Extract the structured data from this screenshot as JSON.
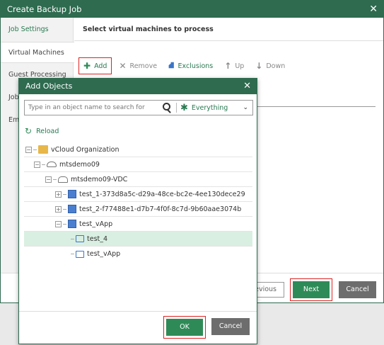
{
  "wizard": {
    "title": "Create Backup Job",
    "steps": [
      "Job Settings",
      "Virtual Machines",
      "Guest Processing",
      "Job",
      "Em"
    ],
    "heading": "Select virtual machines to process",
    "toolbar": {
      "add": "Add",
      "remove": "Remove",
      "exclusions": "Exclusions",
      "up": "Up",
      "down": "Down"
    },
    "footer": {
      "previous": "evious",
      "next": "Next",
      "cancel": "Cancel"
    }
  },
  "dialog": {
    "title": "Add Objects",
    "search_placeholder": "Type in an object name to search for",
    "scope": "Everything",
    "reload": "Reload",
    "tree": [
      {
        "label": "vCloud Organization"
      },
      {
        "label": "mtsdemo09"
      },
      {
        "label": "mtsdemo09-VDC"
      },
      {
        "label": "test_1-373d8a5c-d29a-48ce-bc2e-4ee130dece29"
      },
      {
        "label": "test_2-f77488e1-d7b7-4f0f-8c7d-9b60aae3074b"
      },
      {
        "label": "test_vApp"
      },
      {
        "label": "test_4"
      },
      {
        "label": "test_vApp"
      }
    ],
    "ok": "OK",
    "cancel": "Cancel"
  },
  "colors": {
    "header": "#2e6b4f",
    "accent": "#2a7a52",
    "button": "#2e8b57",
    "highlight": "#dd2222",
    "selected_row": "#d9efe2"
  }
}
